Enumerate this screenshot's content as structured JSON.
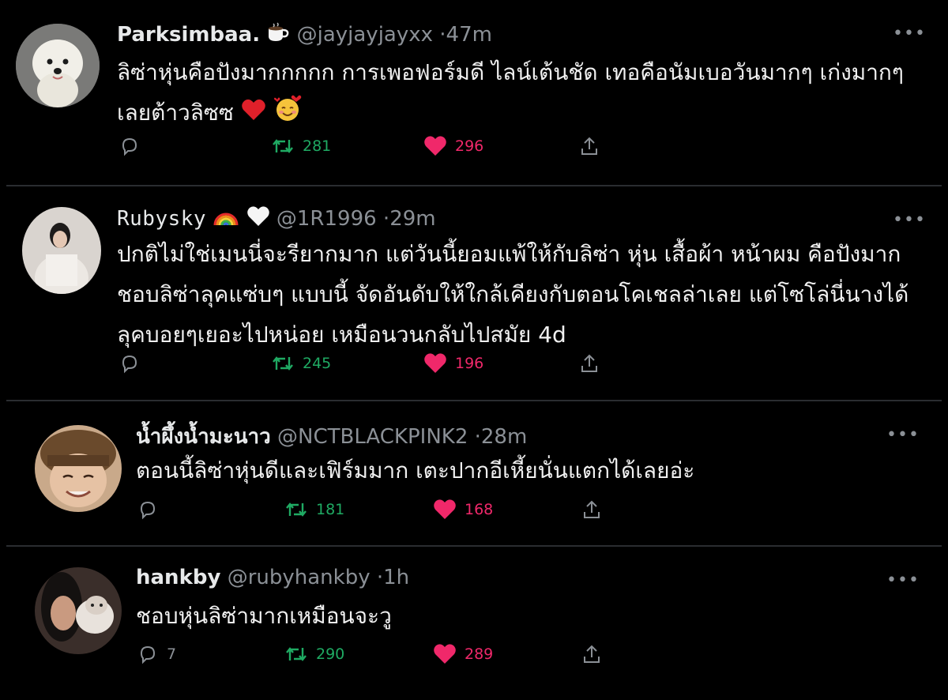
{
  "tweets": [
    {
      "name": "Parksimbaa.",
      "handle": "@jayjayjayxx",
      "time": "47m",
      "text": "ลิซ่าหุ่นคือปังมากกกกก การเพอฟอร์มดี ไลน์เต้นชัด เทอคือนัมเบอวันมากๆ เก่งมากๆเลยต้าวลิซซ",
      "replies": "",
      "retweets": "281",
      "likes": "296",
      "avatar": "white-dog-avatar"
    },
    {
      "name": "Rubysky",
      "handle": "@1R1996",
      "time": "29m",
      "text": "ปกติไม่ใช่เมนนี่จะรียากมาก แต่วันนี้ยอมแพ้ให้กับลิซ่า หุ่น เสื้อผ้า หน้าผม คือปังมาก ชอบลิซ่าลุคแซ่บๆ แบบนี้ จัดอันดับให้ใกล้เคียงกับตอนโคเชลล่าเลย แต่โซโล่นี่นางได้ลุคบอยๆเยอะไปหน่อย เหมือนวนกลับไปสมัย 4d",
      "replies": "",
      "retweets": "245",
      "likes": "196",
      "avatar": "girl-photo-avatar"
    },
    {
      "name": "น้ำผึ้งน้ำมะนาว",
      "handle": "@NCTBLACKPINK2",
      "time": "28m",
      "text": "ตอนนี้ลิซ่าหุ่นดีและเฟิร์มมาก เตะปากอีเหี้ยนั่นแตกได้เลยอ่ะ",
      "replies": "",
      "retweets": "181",
      "likes": "168",
      "avatar": "smiling-boy-avatar"
    },
    {
      "name": "hankby",
      "handle": "@rubyhankby",
      "time": "1h",
      "text": "ชอบหุ่นลิซ่ามากเหมือนจะวู",
      "replies": "7",
      "retweets": "290",
      "likes": "289",
      "avatar": "girl-with-cat-avatar"
    }
  ],
  "colors": {
    "background": "#000000",
    "retweet": "#1faa63",
    "like": "#f0286a",
    "muted": "#8b9096"
  },
  "icons": [
    "reply-icon",
    "retweet-icon",
    "like-icon",
    "share-icon",
    "more-icon",
    "coffee-emoji",
    "rainbow-emoji",
    "white-heart-emoji",
    "red-heart-emoji",
    "smiling-hearts-emoji"
  ]
}
